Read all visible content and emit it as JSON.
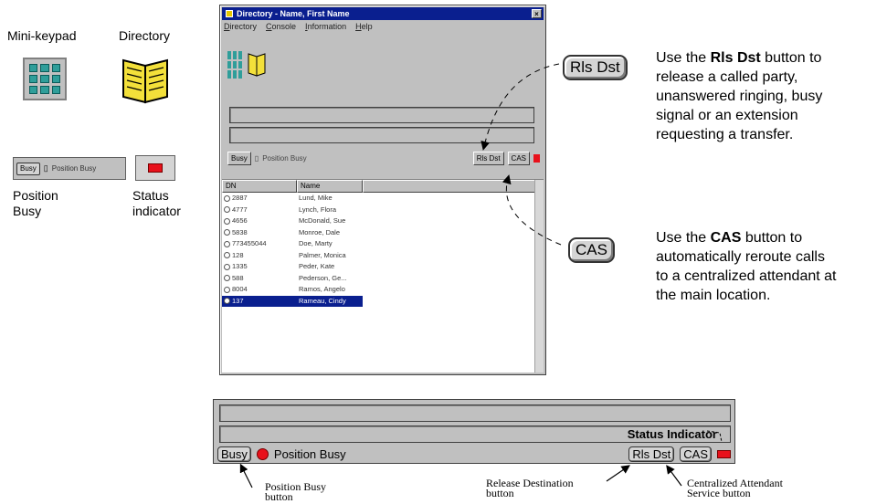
{
  "legend": {
    "mini_keypad_label": "Mini-keypad",
    "directory_label": "Directory",
    "position_busy_label_line1": "Position",
    "position_busy_label_line2": "Busy",
    "status_indicator_label_line1": "Status",
    "status_indicator_label_line2": "indicator",
    "mini_busy_button": "Busy",
    "mini_position_busy_text": "Position Busy"
  },
  "window": {
    "title": "Directory - Name, First Name",
    "menu": [
      "Directory",
      "Console",
      "Information",
      "Help"
    ],
    "busy_button": "Busy",
    "position_busy_text": "Position Busy",
    "rls_dst_button": "Rls Dst",
    "cas_button": "CAS",
    "columns": [
      "DN",
      "Name"
    ],
    "rows": [
      {
        "dn": "2887",
        "name": "Lund, Mike"
      },
      {
        "dn": "4777",
        "name": "Lynch, Flora"
      },
      {
        "dn": "4656",
        "name": "McDonald, Sue"
      },
      {
        "dn": "5838",
        "name": "Monroe, Dale"
      },
      {
        "dn": "773455044",
        "name": "Doe, Marty"
      },
      {
        "dn": "128",
        "name": "Palmer, Monica"
      },
      {
        "dn": "1335",
        "name": "Peder, Kate"
      },
      {
        "dn": "588",
        "name": "Pederson, Ge..."
      },
      {
        "dn": "8004",
        "name": "Ramos, Angelo"
      },
      {
        "dn": "137",
        "name": "Rameau, Cindy"
      }
    ],
    "selected_row": 9
  },
  "rls_dst": {
    "button_label": "Rls Dst",
    "desc_pre": "Use the ",
    "desc_bold": "Rls Dst",
    "desc_lines": [
      "button to",
      "release a called party,",
      "unanswered ringing, busy",
      "signal or an extension",
      "requesting a transfer."
    ]
  },
  "cas": {
    "button_label": "CAS",
    "desc_pre": "Use the ",
    "desc_bold": "CAS",
    "desc_lines": [
      "button to",
      "automatically reroute calls",
      "to a centralized attendant at",
      "the main location."
    ]
  },
  "strip": {
    "status_indicator_label": "Status Indicator",
    "busy_button": "Busy",
    "position_busy_text": "Position Busy",
    "rls_dst_button": "Rls Dst",
    "cas_button": "CAS"
  },
  "callouts": {
    "position_busy": [
      "Position Busy",
      "button"
    ],
    "release_destination": [
      "Release Destination",
      "button"
    ],
    "centralized_attendant": [
      "Centralized Attendant",
      "Service button"
    ]
  },
  "colors": {
    "status_red": "#e8111b",
    "titlebar_blue": "#0a1f8f",
    "keypad_teal": "#2f9e9a"
  }
}
